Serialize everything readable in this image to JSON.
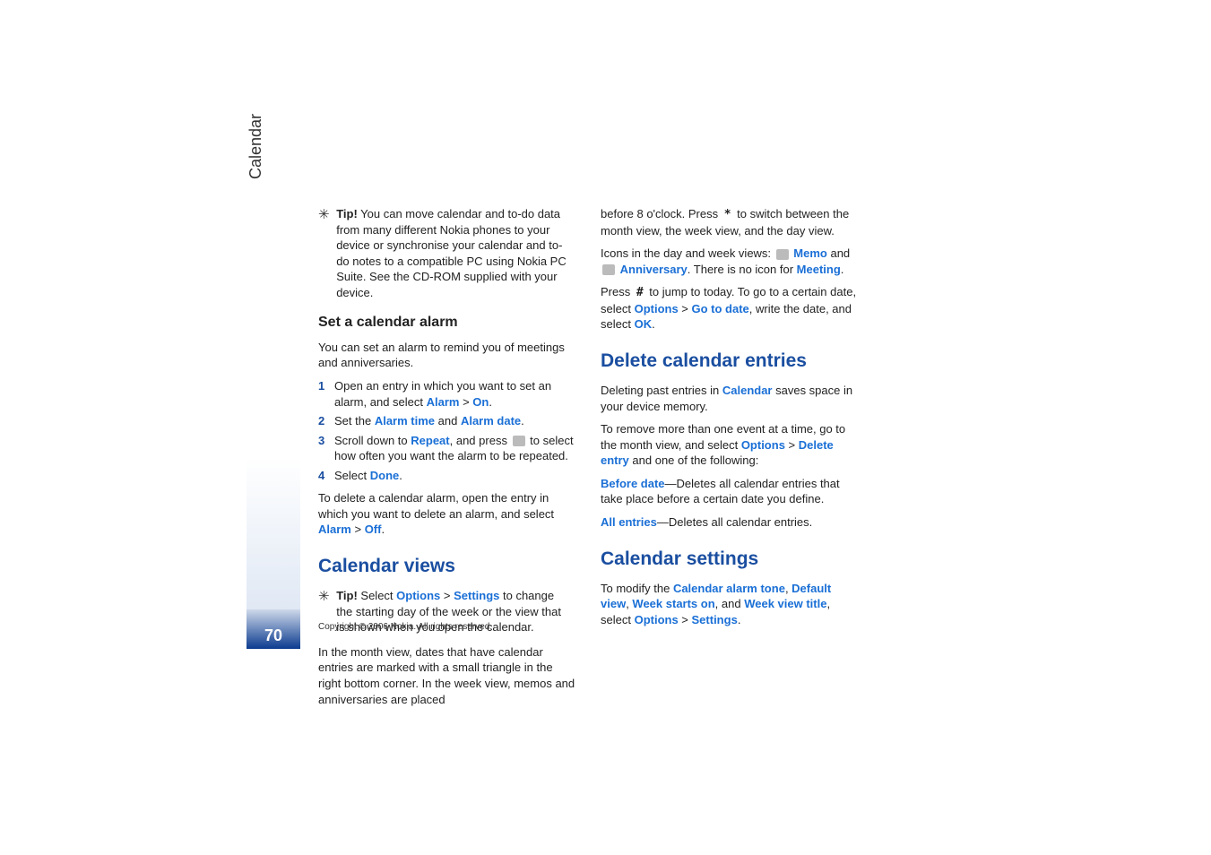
{
  "sideLabel": "Calendar",
  "pageNumber": "70",
  "copyright": "Copyright © 2006 Nokia. All rights reserved.",
  "col1": {
    "tip1_label": "Tip!",
    "tip1_text": " You can move calendar and to-do data from many different Nokia phones to your device or synchronise your calendar and to-do notes to a compatible PC using Nokia PC Suite. See the CD-ROM supplied with your device.",
    "h_set": "Set a calendar alarm",
    "p_set": "You can set an alarm to remind you of meetings and anniversaries.",
    "step1_a": "Open an entry in which you want to set an alarm, and select ",
    "step1_alarm": "Alarm",
    "step1_gt": " > ",
    "step1_on": "On",
    "step1_end": ".",
    "step2_a": "Set the ",
    "step2_time": "Alarm time",
    "step2_and": " and ",
    "step2_date": "Alarm date",
    "step2_end": ".",
    "step3_a": "Scroll down to ",
    "step3_repeat": "Repeat",
    "step3_b": ", and press ",
    "step3_c": " to select how often you want the alarm to be repeated.",
    "step4_a": "Select ",
    "step4_done": "Done",
    "step4_end": ".",
    "p_delete_a": "To delete a calendar alarm, open the entry in which you want to delete an alarm, and select ",
    "p_delete_alarm": "Alarm",
    "p_delete_gt": " > ",
    "p_delete_off": "Off",
    "p_delete_end": ".",
    "h_views": "Calendar views",
    "tip2_label": "Tip!",
    "tip2_a": " Select ",
    "tip2_options": "Options",
    "tip2_gt": " > ",
    "tip2_settings": "Settings",
    "tip2_b": " to change the starting day of the week or the view that is shown when you open the calendar.",
    "p_month": "In the month view, dates that have calendar entries are marked with a small triangle in the right bottom corner. In the week view, memos and anniversaries are placed"
  },
  "col2": {
    "p_before_a": "before 8 o'clock. Press ",
    "p_before_key": "*",
    "p_before_b": " to switch between the month view, the week view, and the day view.",
    "p_icons_a": "Icons in the day and week views: ",
    "p_icons_memo": "Memo",
    "p_icons_and": " and ",
    "p_icons_anniv": "Anniversary",
    "p_icons_b": ". There is no icon for ",
    "p_icons_meeting": "Meeting",
    "p_icons_end": ".",
    "p_press_a": "Press ",
    "p_press_key": "#",
    "p_press_b": " to jump to today. To go to a certain date, select ",
    "p_press_opt": "Options",
    "p_press_gt": " > ",
    "p_press_goto": "Go to date",
    "p_press_c": ", write the date, and select ",
    "p_press_ok": "OK",
    "p_press_end": ".",
    "h_delete": "Delete calendar entries",
    "p_del1_a": "Deleting past entries in ",
    "p_del1_cal": "Calendar",
    "p_del1_b": " saves space in your device memory.",
    "p_del2_a": "To remove more than one event at a time, go to the month view, and select ",
    "p_del2_opt": "Options",
    "p_del2_gt": " > ",
    "p_del2_de": "Delete entry",
    "p_del2_b": " and one of the following:",
    "p_bd_label": "Before date",
    "p_bd_text": "—Deletes all calendar entries that take place before a certain date you define.",
    "p_ae_label": "All entries",
    "p_ae_text": "—Deletes all calendar entries.",
    "h_settings": "Calendar settings",
    "p_set_a": "To modify the ",
    "p_set_tone": "Calendar alarm tone",
    "p_set_c1": ", ",
    "p_set_dv": "Default view",
    "p_set_c2": ", ",
    "p_set_ws": "Week starts on",
    "p_set_c3": ", and ",
    "p_set_wvt": "Week view title",
    "p_set_sel": ", select ",
    "p_set_opt": "Options",
    "p_set_gt": " > ",
    "p_set_set": "Settings",
    "p_set_end": "."
  }
}
